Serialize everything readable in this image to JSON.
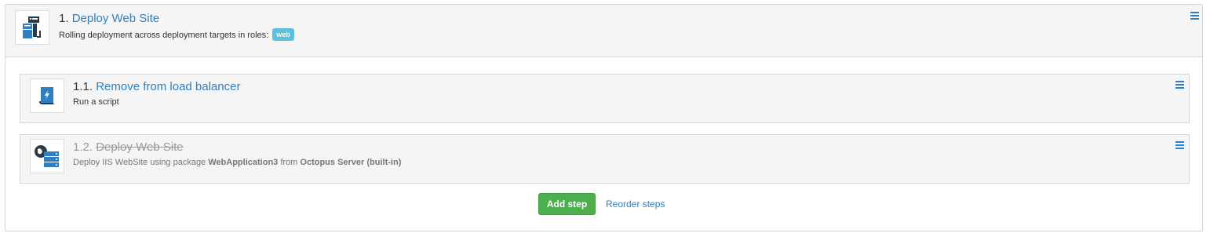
{
  "parent_step": {
    "number": "1.",
    "name": "Deploy Web Site",
    "description": "Rolling deployment across deployment targets in roles:",
    "role_badge": "web",
    "menu_icon": "hamburger-menu-icon",
    "icon": "rolling-deploy-icon"
  },
  "child_steps": [
    {
      "number": "1.1.",
      "name": "Remove from load balancer",
      "description": "Run a script",
      "icon": "script-icon",
      "disabled": false
    },
    {
      "number": "1.2.",
      "name": "Deploy Web Site",
      "description_prefix": "Deploy IIS WebSite using package",
      "package": "WebApplication3",
      "description_middle": "from",
      "feed": "Octopus Server (built-in)",
      "icon": "iis-website-icon",
      "disabled": true
    }
  ],
  "actions": {
    "add_step_label": "Add step",
    "reorder_label": "Reorder steps"
  },
  "colors": {
    "link": "#2f7fc1",
    "badge": "#5bc0de",
    "add_button": "#4cae4c"
  }
}
